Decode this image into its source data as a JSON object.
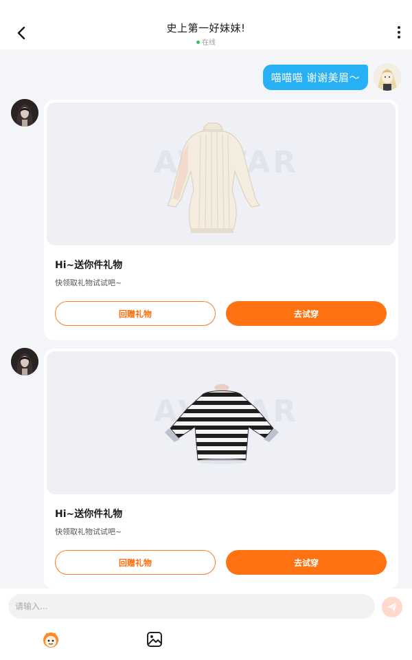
{
  "header": {
    "title": "史上第一好妹妹!",
    "status": "在线"
  },
  "messages": {
    "outgoing_text": "喵喵喵 谢谢美眉～"
  },
  "gifts": [
    {
      "title": "Hi~送你件礼物",
      "subtitle": "快领取礼物试试吧~",
      "return_label": "回赠礼物",
      "try_label": "去试穿",
      "watermark": "AVATAR"
    },
    {
      "title": "Hi~送你件礼物",
      "subtitle": "快领取礼物试试吧~",
      "return_label": "回赠礼物",
      "try_label": "去试穿",
      "watermark": "AVATAR"
    }
  ],
  "input": {
    "placeholder": "请输入..."
  },
  "colors": {
    "accent": "#ff7212",
    "bubble": "#27b0f3",
    "online": "#33c15b"
  }
}
